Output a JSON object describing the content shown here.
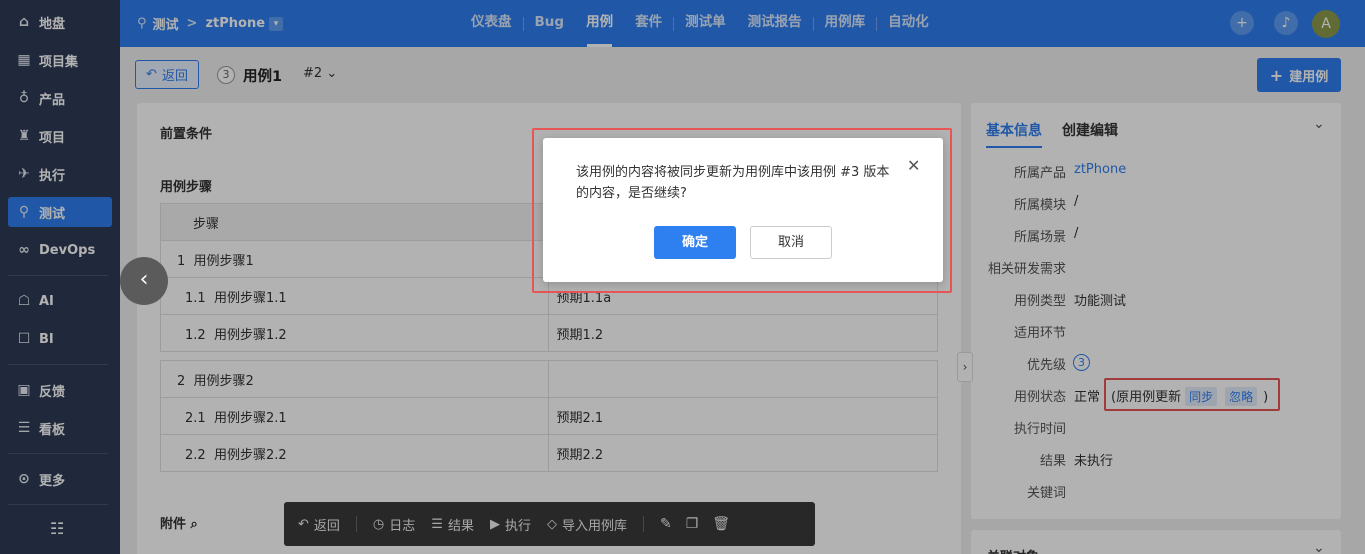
{
  "sidebar": {
    "items": [
      {
        "label": "地盘",
        "icon": "home-icon"
      },
      {
        "label": "项目集",
        "icon": "grid-icon"
      },
      {
        "label": "产品",
        "icon": "bulb-icon"
      },
      {
        "label": "项目",
        "icon": "rocket-icon"
      },
      {
        "label": "执行",
        "icon": "run-icon"
      },
      {
        "label": "测试",
        "icon": "search-icon"
      },
      {
        "label": "DevOps",
        "icon": "infinity-icon"
      },
      {
        "label": "AI",
        "icon": "robot-icon"
      },
      {
        "label": "BI",
        "icon": "chart-icon"
      },
      {
        "label": "反馈",
        "icon": "feedback-icon"
      },
      {
        "label": "看板",
        "icon": "board-icon"
      },
      {
        "label": "更多",
        "icon": "more-icon"
      }
    ]
  },
  "header": {
    "module": "测试",
    "product": "ztPhone",
    "tabs": [
      "仪表盘",
      "Bug",
      "用例",
      "套件",
      "测试单",
      "测试报告",
      "用例库",
      "自动化"
    ],
    "avatar": "A"
  },
  "toolbar": {
    "back_label": "返回",
    "case_id": "3",
    "case_title": "用例1",
    "version": "#2",
    "create_label": "建用例"
  },
  "main": {
    "precondition_title": "前置条件",
    "steps_title": "用例步骤",
    "steps_header": "步骤",
    "steps": [
      {
        "no": "1",
        "text": "用例步骤1",
        "expect": "",
        "group": true
      },
      {
        "no": "1.1",
        "text": "用例步骤1.1",
        "expect": "预期1.1a",
        "group": false
      },
      {
        "no": "1.2",
        "text": "用例步骤1.2",
        "expect": "预期1.2",
        "group": false
      },
      {
        "no": "2",
        "text": "用例步骤2",
        "expect": "",
        "group": true
      },
      {
        "no": "2.1",
        "text": "用例步骤2.1",
        "expect": "预期2.1",
        "group": false
      },
      {
        "no": "2.2",
        "text": "用例步骤2.2",
        "expect": "预期2.2",
        "group": false
      }
    ],
    "attachments_title": "附件"
  },
  "actions": [
    "返回",
    "日志",
    "结果",
    "执行",
    "导入用例库"
  ],
  "info": {
    "tab_basic": "基本信息",
    "tab_create": "创建编辑",
    "fields": [
      {
        "label": "所属产品",
        "value": "ztPhone"
      },
      {
        "label": "所属模块",
        "value": "/"
      },
      {
        "label": "所属场景",
        "value": "/"
      },
      {
        "label": "相关研发需求",
        "value": ""
      },
      {
        "label": "用例类型",
        "value": "功能测试"
      },
      {
        "label": "适用环节",
        "value": ""
      },
      {
        "label": "优先级",
        "value": "3"
      },
      {
        "label": "用例状态",
        "value": "正常"
      },
      {
        "label": "执行时间",
        "value": ""
      },
      {
        "label": "结果",
        "value": "未执行"
      },
      {
        "label": "关键词",
        "value": ""
      }
    ],
    "status_note": "(原用例更新",
    "sync_label": "同步",
    "ignore_label": "忽略",
    "status_close": ")",
    "related_title": "关联对象"
  },
  "dialog": {
    "message": "该用例的内容将被同步更新为用例库中该用例 #3 版本的内容，是否继续?",
    "ok_label": "确定",
    "cancel_label": "取消"
  }
}
